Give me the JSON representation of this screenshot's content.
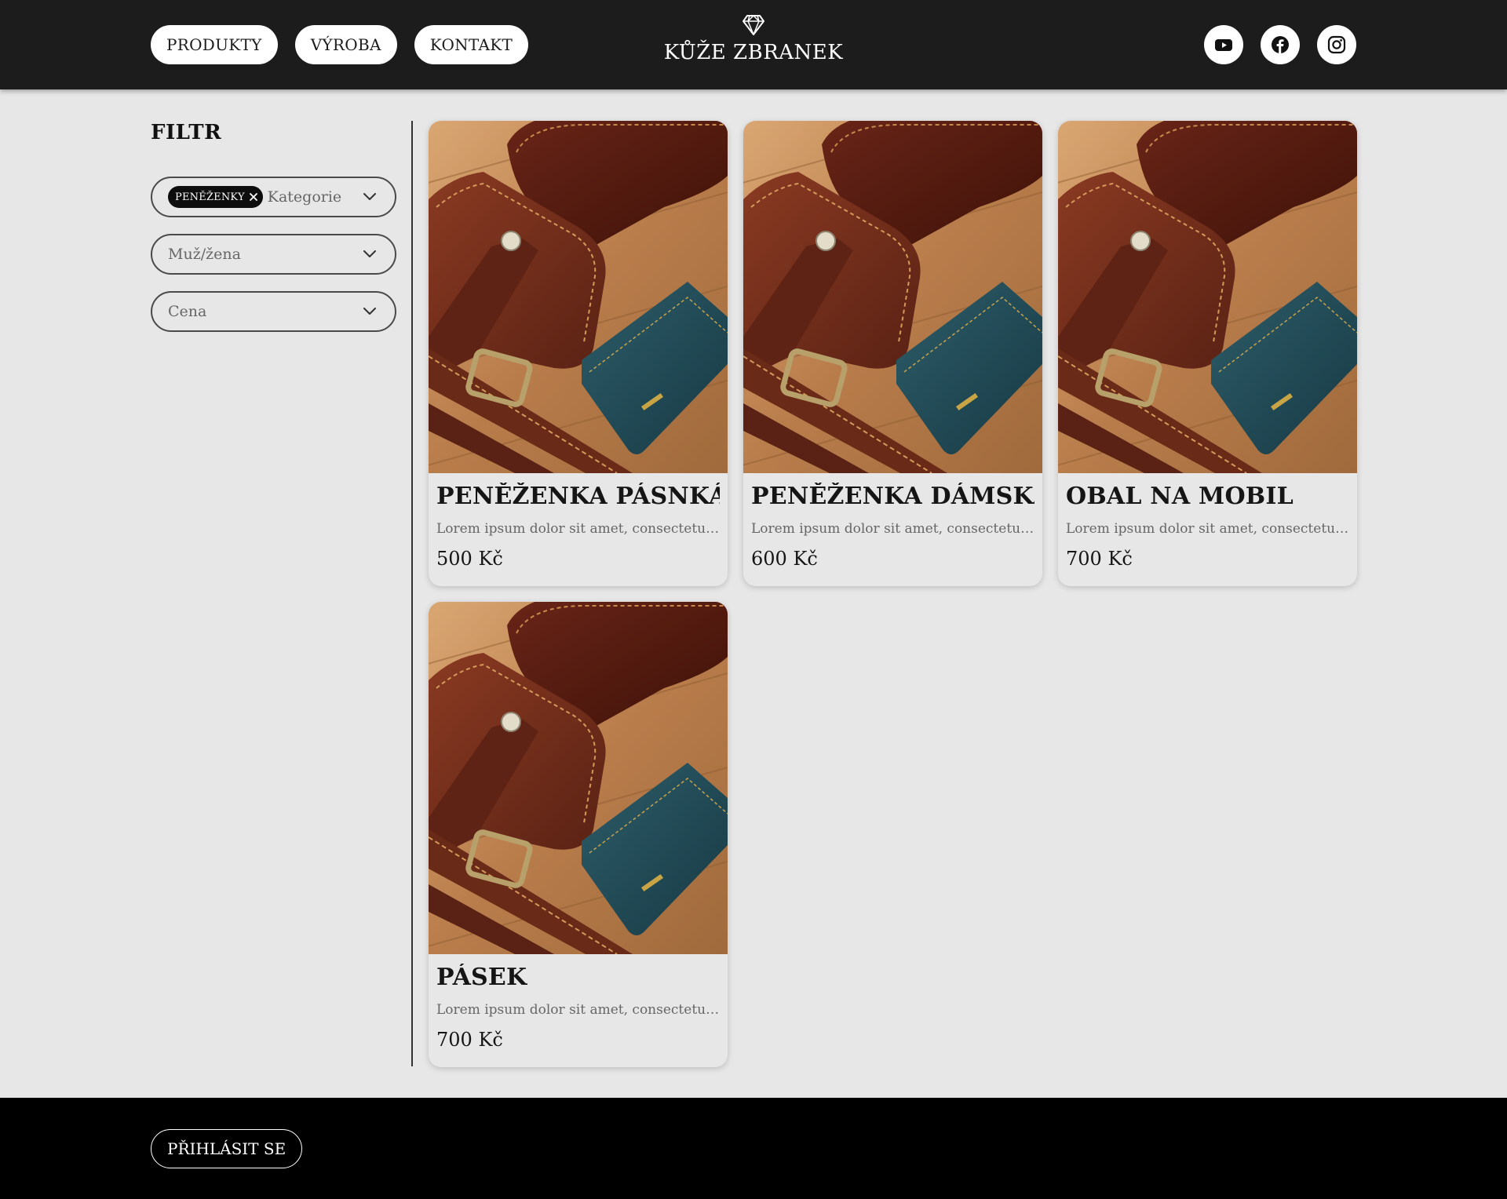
{
  "header": {
    "nav": [
      "PRODUKTY",
      "VÝROBA",
      "KONTAKT"
    ],
    "brand": "KŮŽE ZBRANEK",
    "brand_icon": "diamond-icon",
    "social": [
      "youtube-icon",
      "facebook-icon",
      "instagram-icon"
    ]
  },
  "sidebar": {
    "title": "FILTR",
    "filters": {
      "category": {
        "chip": "PENĚŽENKY",
        "placeholder": "Kategorie"
      },
      "gender": {
        "placeholder": "Muž/žena"
      },
      "price": {
        "placeholder": "Cena"
      }
    }
  },
  "products": [
    {
      "name": "PENĚŽENKA PÁSNKÁ",
      "description": "Lorem ipsum dolor sit amet, consectetuer adipiscing elit.",
      "price": "500 Kč"
    },
    {
      "name": "PENĚŽENKA DÁMSKÁ",
      "description": "Lorem ipsum dolor sit amet, consectetuer adipiscing elit.",
      "price": "600 Kč"
    },
    {
      "name": "OBAL NA MOBIL",
      "description": "Lorem ipsum dolor sit amet, consectetuer adipiscing elit.",
      "price": "700 Kč"
    },
    {
      "name": "PÁSEK",
      "description": "Lorem ipsum dolor sit amet, consectetuer adipiscing elit.",
      "price": "700 Kč"
    }
  ],
  "footer": {
    "login": "PŘIHLÁSIT SE"
  },
  "colors": {
    "header_bg": "#1c1c1c",
    "page_bg": "#e7e7e7",
    "footer_bg": "#000000",
    "leather_brown": "#6e2c1a",
    "leather_teal": "#1f4a55",
    "wood": "#c08a58"
  }
}
